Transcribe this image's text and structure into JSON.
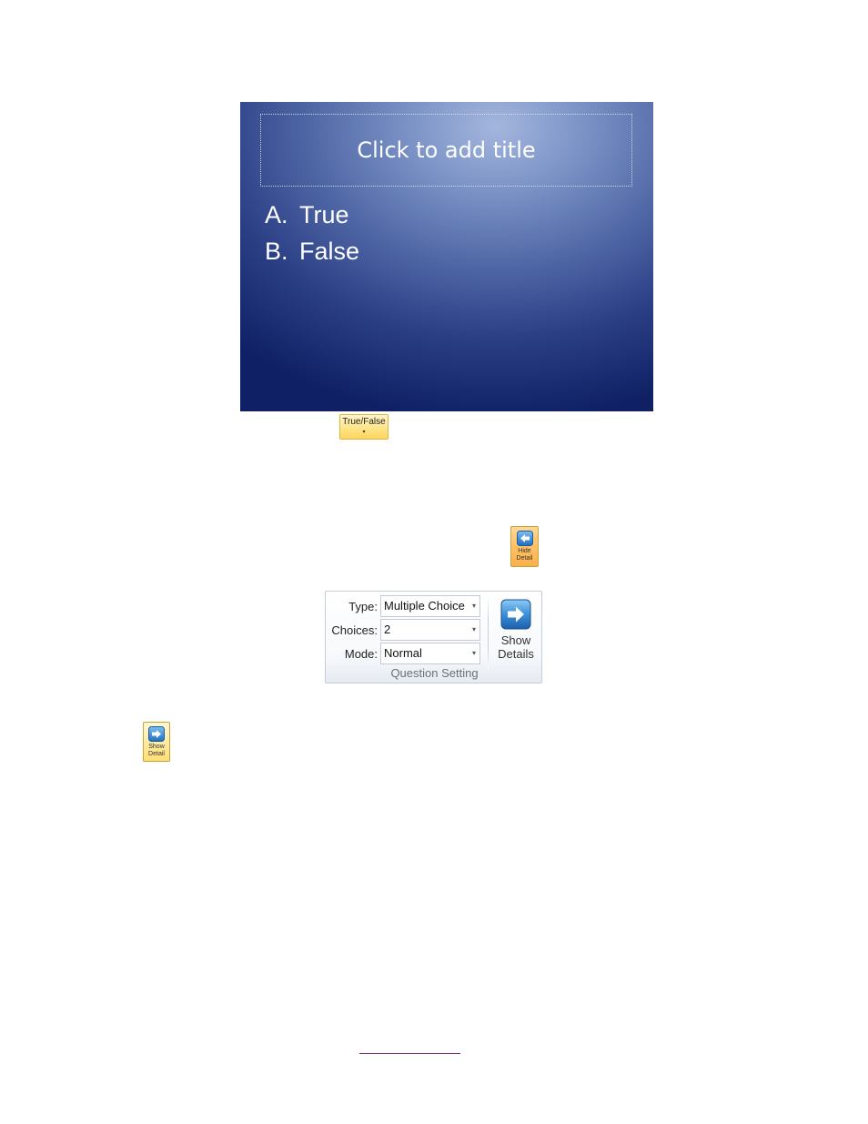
{
  "slide": {
    "title_placeholder": "Click to add title",
    "answers": [
      {
        "letter": "A.",
        "text": "True"
      },
      {
        "letter": "B.",
        "text": "False"
      }
    ]
  },
  "ribbon_buttons": {
    "true_false": {
      "label": "True/False",
      "caret": "▾"
    },
    "hide_detail": {
      "label_line1": "Hide",
      "label_line2": "Detail",
      "icon": "arrow-left-icon"
    },
    "show_detail": {
      "label_line1": "Show",
      "label_line2": "Detail",
      "icon": "arrow-right-icon"
    }
  },
  "question_setting": {
    "group_label": "Question Setting",
    "type": {
      "label": "Type:",
      "value": "Multiple Choice"
    },
    "choices": {
      "label": "Choices:",
      "value": "2"
    },
    "mode": {
      "label": "Mode:",
      "value": "Normal"
    },
    "show_details": {
      "line1": "Show",
      "line2": "Details",
      "icon": "arrow-right-icon"
    },
    "dropdown_glyph": "▾"
  },
  "colors": {
    "slide_dark": "#0f2064",
    "slide_light": "#a4b6dd",
    "button_yellow": "#ffe48a",
    "button_orange": "#ffc36a",
    "link_underline": "#7a2c6e"
  }
}
